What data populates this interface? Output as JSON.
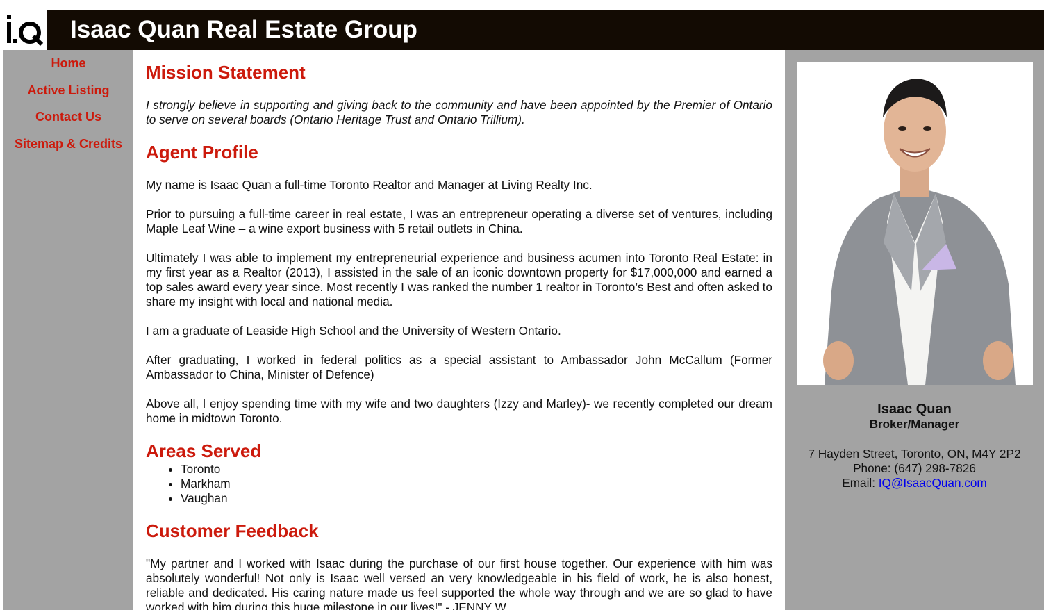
{
  "header": {
    "logo_text": "i.Q",
    "title": "Isaac Quan Real Estate Group"
  },
  "nav": [
    {
      "label": "Home"
    },
    {
      "label": "Active Listing"
    },
    {
      "label": "Contact Us"
    },
    {
      "label": "Sitemap & Credits"
    }
  ],
  "main": {
    "mission": {
      "heading": "Mission Statement",
      "text": "I strongly believe in supporting and giving back to the community and have been appointed by the Premier of Ontario to serve on several boards (Ontario Heritage Trust and Ontario Trillium)."
    },
    "profile": {
      "heading": "Agent Profile",
      "paragraphs": [
        "My name is Isaac Quan a full-time Toronto Realtor and Manager at Living Realty Inc.",
        "Prior to pursuing a full-time career in real estate, I was an entrepreneur operating a diverse set of ventures, including Maple Leaf Wine – a wine export business with 5 retail outlets in China.",
        "Ultimately I was able to implement my entrepreneurial experience and business acumen into Toronto Real Estate: in my first year as a Realtor (2013), I assisted in the sale of an iconic downtown property for $17,000,000 and earned a top sales award every year since. Most recently I was ranked the number 1 realtor in Toronto’s Best and often asked to share my insight with local and national media.",
        "I am a graduate of Leaside High School and the University of Western Ontario.",
        "After graduating, I worked in federal politics as a special assistant to Ambassador John McCallum (Former Ambassador to China, Minister of Defence)",
        "Above all, I enjoy spending time with my wife and two daughters (Izzy and Marley)- we recently completed our dream home in midtown Toronto."
      ]
    },
    "areas": {
      "heading": "Areas Served",
      "items": [
        "Toronto",
        "Markham",
        "Vaughan"
      ]
    },
    "feedback": {
      "heading": "Customer Feedback",
      "text": "\"My partner and I worked with Isaac during the purchase of our first house together. Our experience with him was absolutely wonderful! Not only is Isaac well versed an very knowledgeable in his field of work, he is also honest, reliable and dedicated. His caring nature made us feel supported the whole way through and we are so glad to have worked with him during this huge milestone in our lives!\" - JENNY W."
    }
  },
  "agent": {
    "name": "Isaac Quan",
    "title": "Broker/Manager",
    "address": "7 Hayden Street, Toronto, ON, M4Y 2P2",
    "phone": "Phone: (647) 298-7826",
    "email_label": "Email: ",
    "email": "IQ@IsaacQuan.com"
  },
  "colors": {
    "accent": "#cc1a0c",
    "header_bg": "#130b03",
    "sidebar_bg": "#a3a3a3",
    "link": "#0000ee"
  }
}
